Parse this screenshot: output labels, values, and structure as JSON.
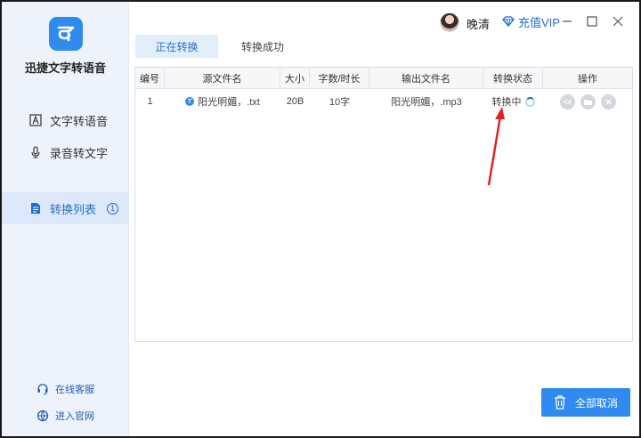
{
  "sidebar": {
    "app_name": "迅捷文字转语音",
    "nav": [
      {
        "label": "文字转语音",
        "icon": "text-document-icon"
      },
      {
        "label": "录音转文字",
        "icon": "microphone-icon"
      },
      {
        "label": "转换列表",
        "icon": "list-document-icon",
        "badge": "1"
      }
    ],
    "footer": [
      {
        "label": "在线客服",
        "icon": "headset-icon"
      },
      {
        "label": "进入官网",
        "icon": "globe-icon"
      }
    ]
  },
  "header": {
    "username": "晚清",
    "vip_label": "充值VIP"
  },
  "tabs": [
    {
      "label": "正在转换",
      "active": true
    },
    {
      "label": "转换成功",
      "active": false
    }
  ],
  "table": {
    "columns": [
      "编号",
      "源文件名",
      "大小",
      "字数/时长",
      "输出文件名",
      "转换状态",
      "操作"
    ],
    "rows": [
      {
        "id": "1",
        "source": "阳光明媚，.txt",
        "size": "20B",
        "length": "10字",
        "output": "阳光明媚，.mp3",
        "status": "转换中"
      }
    ]
  },
  "actions": {
    "cancel_all": "全部取消"
  },
  "colors": {
    "accent": "#2f8bf0",
    "sidebar_bg": "#eef3fb",
    "annotation": "#e02020"
  }
}
